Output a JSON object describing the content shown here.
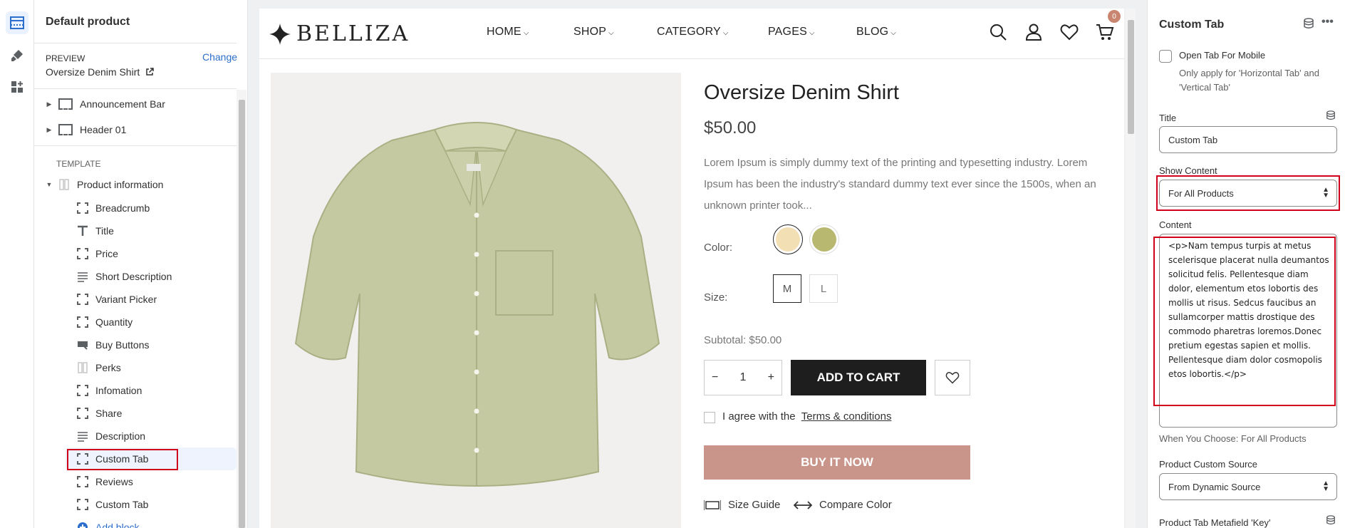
{
  "left_panel": {
    "title": "Default product",
    "preview_label": "PREVIEW",
    "change_label": "Change",
    "preview_product": "Oversize Denim Shirt",
    "sections": [
      {
        "label": "Announcement Bar"
      },
      {
        "label": "Header 01"
      }
    ],
    "template_label": "TEMPLATE",
    "template_section": "Product information",
    "blocks": [
      {
        "label": "Breadcrumb",
        "icon": "dashed-frame-icon"
      },
      {
        "label": "Title",
        "icon": "text-icon"
      },
      {
        "label": "Price",
        "icon": "dashed-frame-icon"
      },
      {
        "label": "Short Description",
        "icon": "paragraph-icon"
      },
      {
        "label": "Variant Picker",
        "icon": "dashed-frame-icon"
      },
      {
        "label": "Quantity",
        "icon": "dashed-frame-icon"
      },
      {
        "label": "Buy Buttons",
        "icon": "buy-button-icon"
      },
      {
        "label": "Perks",
        "icon": "columns-icon"
      },
      {
        "label": "Infomation",
        "icon": "dashed-frame-icon"
      },
      {
        "label": "Share",
        "icon": "dashed-frame-icon"
      },
      {
        "label": "Description",
        "icon": "paragraph-icon"
      },
      {
        "label": "Custom Tab",
        "icon": "dashed-frame-icon",
        "selected": true
      },
      {
        "label": "Reviews",
        "icon": "dashed-frame-icon"
      },
      {
        "label": "Custom Tab",
        "icon": "dashed-frame-icon"
      },
      {
        "label": "Add block",
        "icon": "plus-circle-icon"
      }
    ]
  },
  "store": {
    "logo": "BELLIZA",
    "nav": [
      "HOME",
      "SHOP",
      "CATEGORY",
      "PAGES",
      "BLOG"
    ],
    "cart_count": "0"
  },
  "product": {
    "title": "Oversize Denim Shirt",
    "price": "$50.00",
    "description": "Lorem Ipsum is simply dummy text of the printing and typesetting industry. Lorem Ipsum has been the industry's standard dummy text ever since the 1500s, when an unknown printer took...",
    "color_label": "Color:",
    "colors": [
      "#f3dfb4",
      "#b8b870"
    ],
    "size_label": "Size:",
    "sizes": [
      "M",
      "L"
    ],
    "subtotal": "Subtotal: $50.00",
    "quantity": "1",
    "add_to_cart": "ADD TO CART",
    "agree_text": "I agree with the",
    "terms_link": "Terms & conditions",
    "buy_now": "BUY IT NOW",
    "size_guide": "Size Guide",
    "compare_color": "Compare Color",
    "shirt_color": "#c5c9a2"
  },
  "right_panel": {
    "title": "Custom Tab",
    "open_mobile_label": "Open Tab For Mobile",
    "open_mobile_help_1": "Only apply for 'Horizontal Tab' and",
    "open_mobile_help_2": "'Vertical Tab'",
    "title_label": "Title",
    "title_value": "Custom Tab",
    "show_content_label": "Show Content",
    "show_content_value": "For All Products",
    "content_label": "Content",
    "content_value": "<p>Nam tempus turpis at metus scelerisque placerat nulla deumantos solicitud felis. Pellentesque diam dolor, elementum etos lobortis des mollis ut risus. Sedcus faucibus an sullamcorper mattis drostique des commodo pharetras loremos.Donec pretium egestas sapien et mollis. Pellentesque diam dolor cosmopolis etos lobortis.</p>",
    "choose_hint": "When You Choose: For All Products",
    "source_label": "Product Custom Source",
    "source_value": "From Dynamic Source",
    "metafield_label": "Product Tab Metafield 'Key'"
  },
  "colors": {
    "highlight_red": "#d0021b",
    "accent_blue": "#2c6ecb",
    "buy_now": "#c9958a",
    "dark_button": "#1e1e1e"
  }
}
